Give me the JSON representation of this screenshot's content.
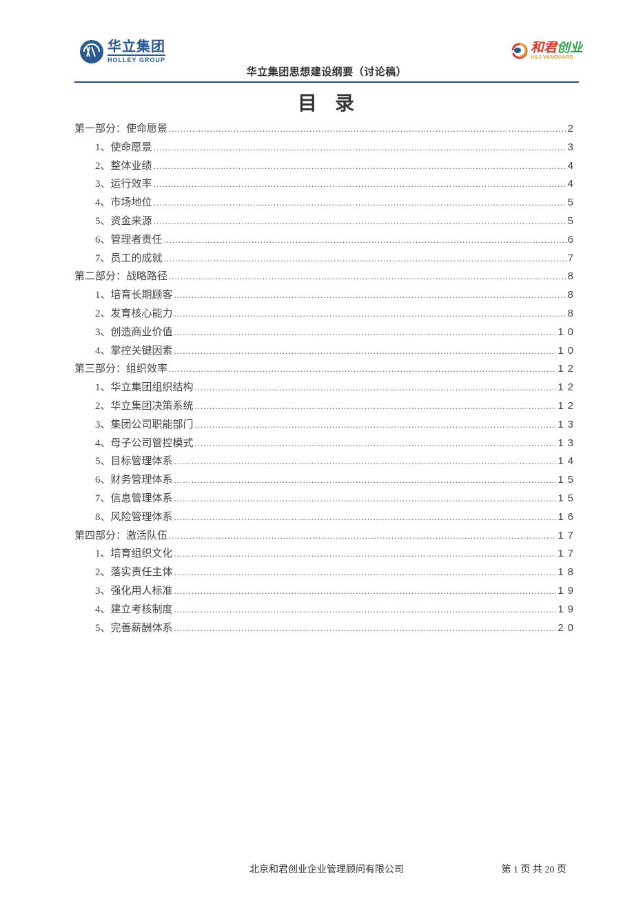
{
  "header": {
    "left_logo_cn": "华立集团",
    "left_logo_en": "HOLLEY GROUP",
    "doc_subtitle": "华立集团思想建设纲要（讨论稿）",
    "right_logo_cn": "和君创业",
    "right_logo_en": "H&J VANGUARD"
  },
  "title": "目录",
  "toc": [
    {
      "level": 0,
      "label": "第一部分：使命愿景",
      "page": "2"
    },
    {
      "level": 1,
      "label": "1、使命愿景",
      "page": "3"
    },
    {
      "level": 1,
      "label": "2、整体业绩",
      "page": "4"
    },
    {
      "level": 1,
      "label": "3、运行效率",
      "page": "4"
    },
    {
      "level": 1,
      "label": "4、市场地位",
      "page": "5"
    },
    {
      "level": 1,
      "label": "5、资金来源",
      "page": "5"
    },
    {
      "level": 1,
      "label": "6、管理者责任",
      "page": "6"
    },
    {
      "level": 1,
      "label": "7、员工的成就",
      "page": "7"
    },
    {
      "level": 0,
      "label": "第二部分：战略路径",
      "page": "8"
    },
    {
      "level": 1,
      "label": "1、培育长期顾客",
      "page": "8"
    },
    {
      "level": 1,
      "label": "2、发育核心能力",
      "page": "8"
    },
    {
      "level": 1,
      "label": "3、创造商业价值",
      "page": "10"
    },
    {
      "level": 1,
      "label": "4、掌控关键因素",
      "page": "10"
    },
    {
      "level": 0,
      "label": "第三部分：组织效率",
      "page": "12"
    },
    {
      "level": 1,
      "label": "1、华立集团组织结构",
      "page": "12"
    },
    {
      "level": 1,
      "label": "2、华立集团决策系统",
      "page": "12"
    },
    {
      "level": 1,
      "label": "3、集团公司职能部门",
      "page": "13"
    },
    {
      "level": 1,
      "label": "4、母子公司管控模式",
      "page": "13"
    },
    {
      "level": 1,
      "label": "5、目标管理体系",
      "page": "14"
    },
    {
      "level": 1,
      "label": "6、财务管理体系",
      "page": "15"
    },
    {
      "level": 1,
      "label": "7、信息管理体系",
      "page": "15"
    },
    {
      "level": 1,
      "label": "8、风险管理体系",
      "page": "16"
    },
    {
      "level": 0,
      "label": "第四部分：激活队伍",
      "page": "17"
    },
    {
      "level": 1,
      "label": "1、培育组织文化",
      "page": "17"
    },
    {
      "level": 1,
      "label": "2、落实责任主体",
      "page": "18"
    },
    {
      "level": 1,
      "label": "3、强化用人标准",
      "page": "19"
    },
    {
      "level": 1,
      "label": "4、建立考核制度",
      "page": "19"
    },
    {
      "level": 1,
      "label": "5、完善薪酬体系",
      "page": "20"
    }
  ],
  "footer": {
    "company": "北京和君创业企业管理顾问有限公司",
    "page_text": "第 1 页 共 20 页"
  }
}
